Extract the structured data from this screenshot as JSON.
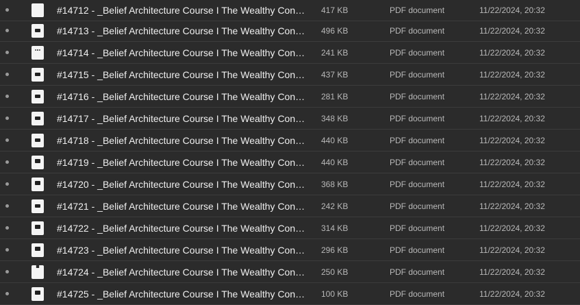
{
  "files": [
    {
      "name": "#14712 - _Belief Architecture Course I The Wealthy Cons...",
      "size": "417 KB",
      "type": "PDF document",
      "modified": "11/22/2024, 20:32",
      "icon": "pdf-thumbnail-icon"
    },
    {
      "name": "#14713 - _Belief Architecture Course I The Wealthy Cons...",
      "size": "496 KB",
      "type": "PDF document",
      "modified": "11/22/2024, 20:32",
      "icon": "pdf-thumbnail-icon"
    },
    {
      "name": "#14714 - _Belief Architecture Course I The Wealthy Cons...",
      "size": "241 KB",
      "type": "PDF document",
      "modified": "11/22/2024, 20:32",
      "icon": "pdf-thumbnail-icon"
    },
    {
      "name": "#14715 - _Belief Architecture Course I The Wealthy Cons...",
      "size": "437 KB",
      "type": "PDF document",
      "modified": "11/22/2024, 20:32",
      "icon": "pdf-thumbnail-icon"
    },
    {
      "name": "#14716 - _Belief Architecture Course I The Wealthy Cons...",
      "size": "281 KB",
      "type": "PDF document",
      "modified": "11/22/2024, 20:32",
      "icon": "pdf-thumbnail-icon"
    },
    {
      "name": "#14717 - _Belief Architecture Course I The Wealthy Cons...",
      "size": "348 KB",
      "type": "PDF document",
      "modified": "11/22/2024, 20:32",
      "icon": "pdf-thumbnail-icon"
    },
    {
      "name": "#14718 - _Belief Architecture Course I The Wealthy Cons...",
      "size": "440 KB",
      "type": "PDF document",
      "modified": "11/22/2024, 20:32",
      "icon": "pdf-thumbnail-icon"
    },
    {
      "name": "#14719 - _Belief Architecture Course I The Wealthy Cons...",
      "size": "440 KB",
      "type": "PDF document",
      "modified": "11/22/2024, 20:32",
      "icon": "pdf-thumbnail-icon"
    },
    {
      "name": "#14720 - _Belief Architecture Course I The Wealthy Cons...",
      "size": "368 KB",
      "type": "PDF document",
      "modified": "11/22/2024, 20:32",
      "icon": "pdf-thumbnail-icon"
    },
    {
      "name": "#14721 - _Belief Architecture Course I The Wealthy Cons...",
      "size": "242 KB",
      "type": "PDF document",
      "modified": "11/22/2024, 20:32",
      "icon": "pdf-thumbnail-icon"
    },
    {
      "name": "#14722 - _Belief Architecture Course I The Wealthy Cons...",
      "size": "314 KB",
      "type": "PDF document",
      "modified": "11/22/2024, 20:32",
      "icon": "pdf-thumbnail-icon"
    },
    {
      "name": "#14723 - _Belief Architecture Course I The Wealthy Cons...",
      "size": "296 KB",
      "type": "PDF document",
      "modified": "11/22/2024, 20:32",
      "icon": "pdf-thumbnail-icon"
    },
    {
      "name": "#14724 - _Belief Architecture Course I The Wealthy Cons...",
      "size": "250 KB",
      "type": "PDF document",
      "modified": "11/22/2024, 20:32",
      "icon": "pdf-thumbnail-icon"
    },
    {
      "name": "#14725 - _Belief Architecture Course I The Wealthy Cons...",
      "size": "100 KB",
      "type": "PDF document",
      "modified": "11/22/2024, 20:32",
      "icon": "pdf-thumbnail-icon"
    }
  ],
  "colors": {
    "background": "#2b2b2b",
    "divider": "#3c3c3c",
    "name_text": "#efefef",
    "meta_text": "#b9b9b9"
  }
}
